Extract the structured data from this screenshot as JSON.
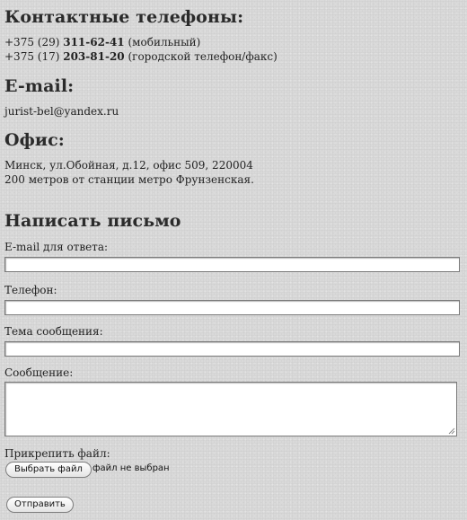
{
  "phones": {
    "heading": "Контактные телефоны:",
    "lines": [
      {
        "prefix": "+375 (29)",
        "number": "311-62-41",
        "note": "(мобильный)"
      },
      {
        "prefix": "+375 (17)",
        "number": "203-81-20",
        "note": "(городской телефон/факс)"
      }
    ]
  },
  "email": {
    "heading": "E-mail:",
    "value": "jurist-bel@yandex.ru"
  },
  "office": {
    "heading": "Офис:",
    "address": "Минск, ул.Обойная, д.12, офис 509, 220004",
    "note": "200 метров от станции метро Фрунзенская."
  },
  "form": {
    "heading": "Написать письмо",
    "reply_email_label": "E-mail для ответа:",
    "reply_email_value": "",
    "phone_label": "Телефон:",
    "phone_value": "",
    "subject_label": "Тема сообщения:",
    "subject_value": "",
    "message_label": "Сообщение:",
    "message_value": "",
    "attach_label": "Прикрепить файл:",
    "choose_file_button": "Выбрать файл",
    "no_file_text": "файл не выбран",
    "submit_button": "Отправить"
  }
}
